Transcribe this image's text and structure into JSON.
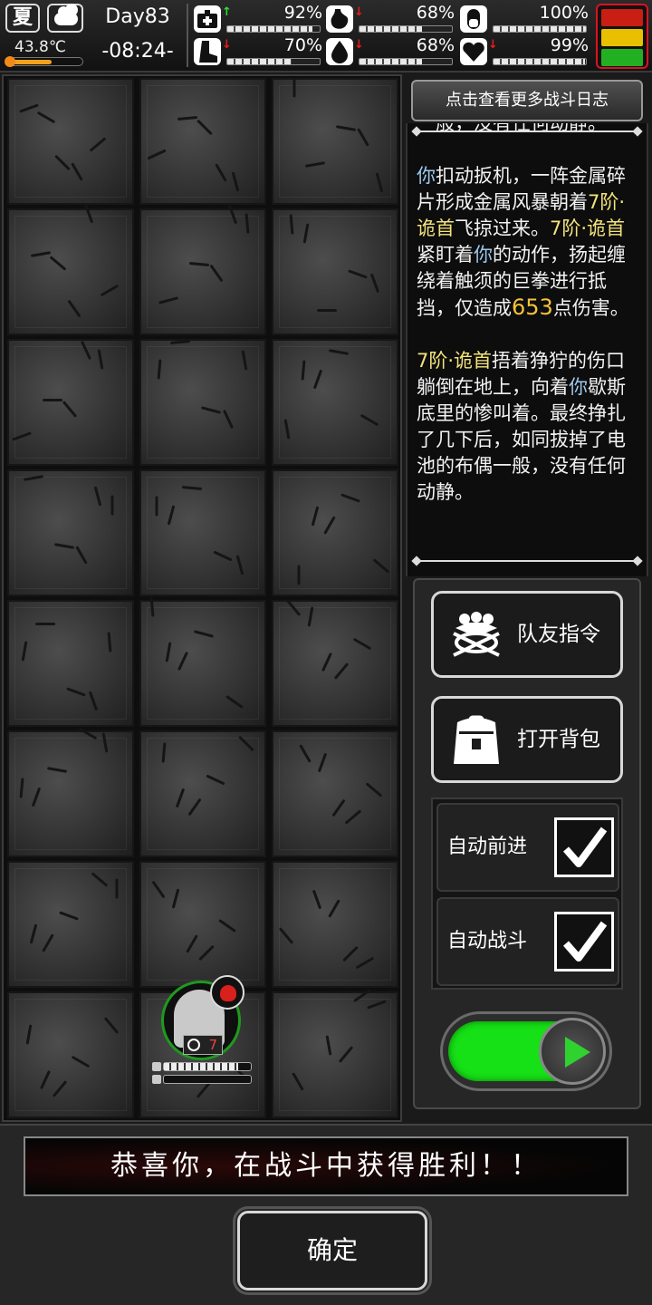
{
  "status": {
    "season": "夏",
    "weather_icon": "cloud-icon",
    "temperature": "43.8℃",
    "temperature_level": 0.6,
    "day": "Day83",
    "time": "-08:24-",
    "stats": [
      {
        "name": "health",
        "icon": "medkit-icon",
        "trend": "up",
        "value": "92%",
        "level": 0.92
      },
      {
        "name": "hunger",
        "icon": "stomach-icon",
        "trend": "down",
        "value": "68%",
        "level": 0.68
      },
      {
        "name": "medicine",
        "icon": "pill-icon",
        "trend": "none",
        "value": "100%",
        "level": 1.0
      },
      {
        "name": "stamina",
        "icon": "boot-icon",
        "trend": "down",
        "value": "70%",
        "level": 0.7
      },
      {
        "name": "thirst",
        "icon": "water-drop-icon",
        "trend": "down",
        "value": "68%",
        "level": 0.68
      },
      {
        "name": "mood",
        "icon": "heart-icon",
        "trend": "down",
        "value": "99%",
        "level": 0.99
      }
    ],
    "signal_colors": [
      "#c81e14",
      "#e8c000",
      "#22b022"
    ]
  },
  "map": {
    "player_level": "7",
    "player_hp_level": 0.85,
    "player_energy_level": 0.0
  },
  "log": {
    "more_button": "点击查看更多战斗日志",
    "entry0_tail": "一般，没有任何动静。",
    "entry1": {
      "actor": "你",
      "t1": "扣动扳机，一阵金属碎片形成金属风暴朝着",
      "enemy1": "7阶·诡首",
      "t2": "飞掠过来。",
      "enemy2": "7阶·诡首",
      "t3": "紧盯着",
      "actor2": "你",
      "t4": "的动作，扬起缠绕着触须的巨拳进行抵挡，仅造成",
      "damage": "653",
      "t5": "点伤害。"
    },
    "entry2": {
      "enemy": "7阶·诡首",
      "t1": "捂着狰狞的伤口躺倒在地上，向着",
      "actor": "你",
      "t2": "歇斯底里的惨叫着。最终挣扎了几下后，如同拔掉了电池的布偶一般，没有任何动静。"
    }
  },
  "commands": {
    "team_button": "队友指令",
    "bag_button": "打开背包",
    "auto_advance_label": "自动前进",
    "auto_advance_checked": true,
    "auto_battle_label": "自动战斗",
    "auto_battle_checked": true
  },
  "result": {
    "message": "恭喜你，在战斗中获得胜利！！",
    "confirm_button": "确定"
  }
}
